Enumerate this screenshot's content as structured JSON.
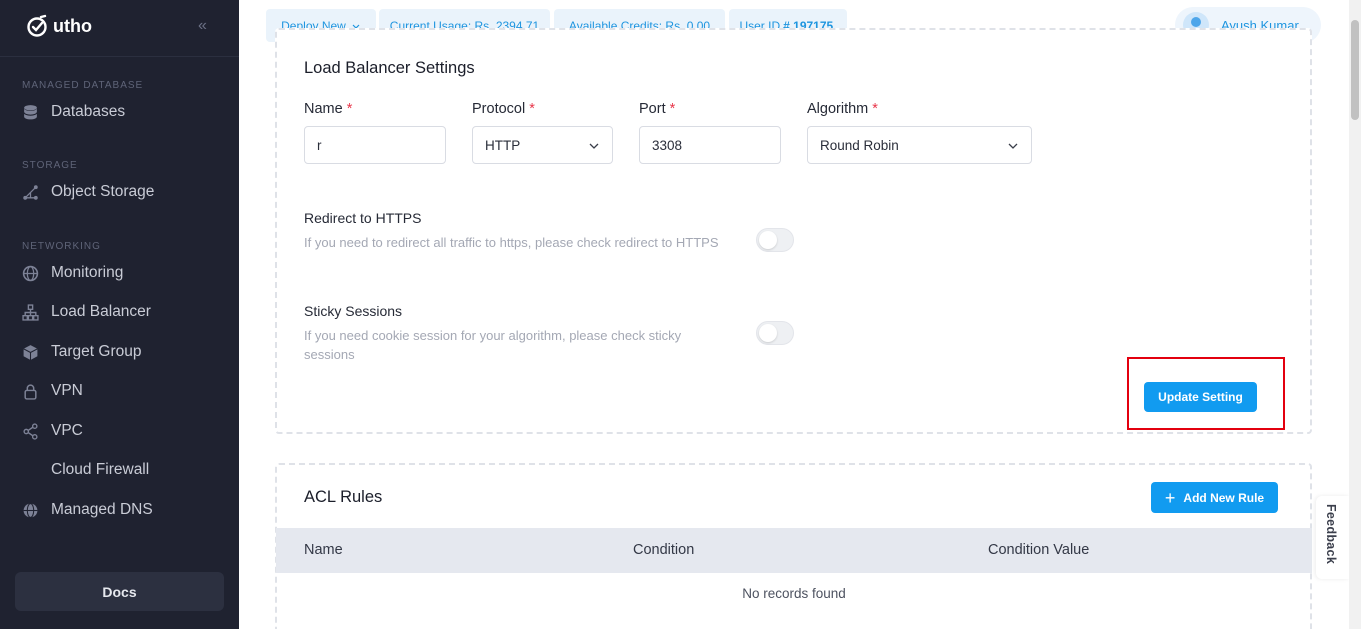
{
  "app": {
    "brand": "utho"
  },
  "sidebar": {
    "sections": [
      {
        "label": "MANAGED DATABASE",
        "items": [
          {
            "label": "Databases",
            "icon": "database-icon"
          }
        ]
      },
      {
        "label": "STORAGE",
        "items": [
          {
            "label": "Object Storage",
            "icon": "object-storage-icon"
          }
        ]
      },
      {
        "label": "NETWORKING",
        "items": [
          {
            "label": "Monitoring",
            "icon": "globe-icon"
          },
          {
            "label": "Load Balancer",
            "icon": "sitemap-icon"
          },
          {
            "label": "Target Group",
            "icon": "cube-icon"
          },
          {
            "label": "VPN",
            "icon": "lock-icon"
          },
          {
            "label": "VPC",
            "icon": "share-icon"
          },
          {
            "label": "Cloud Firewall",
            "icon": "cloud-icon"
          },
          {
            "label": "Managed DNS",
            "icon": "globe-icon"
          }
        ]
      }
    ],
    "docs_label": "Docs"
  },
  "topbar": {
    "deploy_label": "Deploy New",
    "usage_label": "Current Usage: Rs. 2394.71",
    "credits_label": "Available Credits: Rs. 0.00",
    "user_id_prefix": "User ID",
    "user_id_value": "# 197175.",
    "user_name": "Ayush Kumar"
  },
  "lb_settings": {
    "title": "Load Balancer Settings",
    "name": {
      "label": "Name",
      "value": "r"
    },
    "protocol": {
      "label": "Protocol",
      "value": "HTTP"
    },
    "port": {
      "label": "Port",
      "value": "3308"
    },
    "algorithm": {
      "label": "Algorithm",
      "value": "Round Robin"
    },
    "required_mark": "*",
    "redirect": {
      "title": "Redirect to HTTPS",
      "desc": "If you need to redirect all traffic to https, please check redirect to HTTPS",
      "enabled": false
    },
    "sticky": {
      "title": "Sticky Sessions",
      "desc": "If you need cookie session for your algorithm, please check sticky sessions",
      "enabled": false
    },
    "update_button": "Update Setting"
  },
  "acl": {
    "title": "ACL Rules",
    "add_button": "Add New Rule",
    "columns": [
      "Name",
      "Condition",
      "Condition Value"
    ],
    "empty_text": "No records found"
  },
  "feedback_label": "Feedback",
  "colors": {
    "accent": "#119bf0",
    "sidebar_bg": "#1f2230",
    "highlight": "#e3000f",
    "required": "#e8364a"
  }
}
